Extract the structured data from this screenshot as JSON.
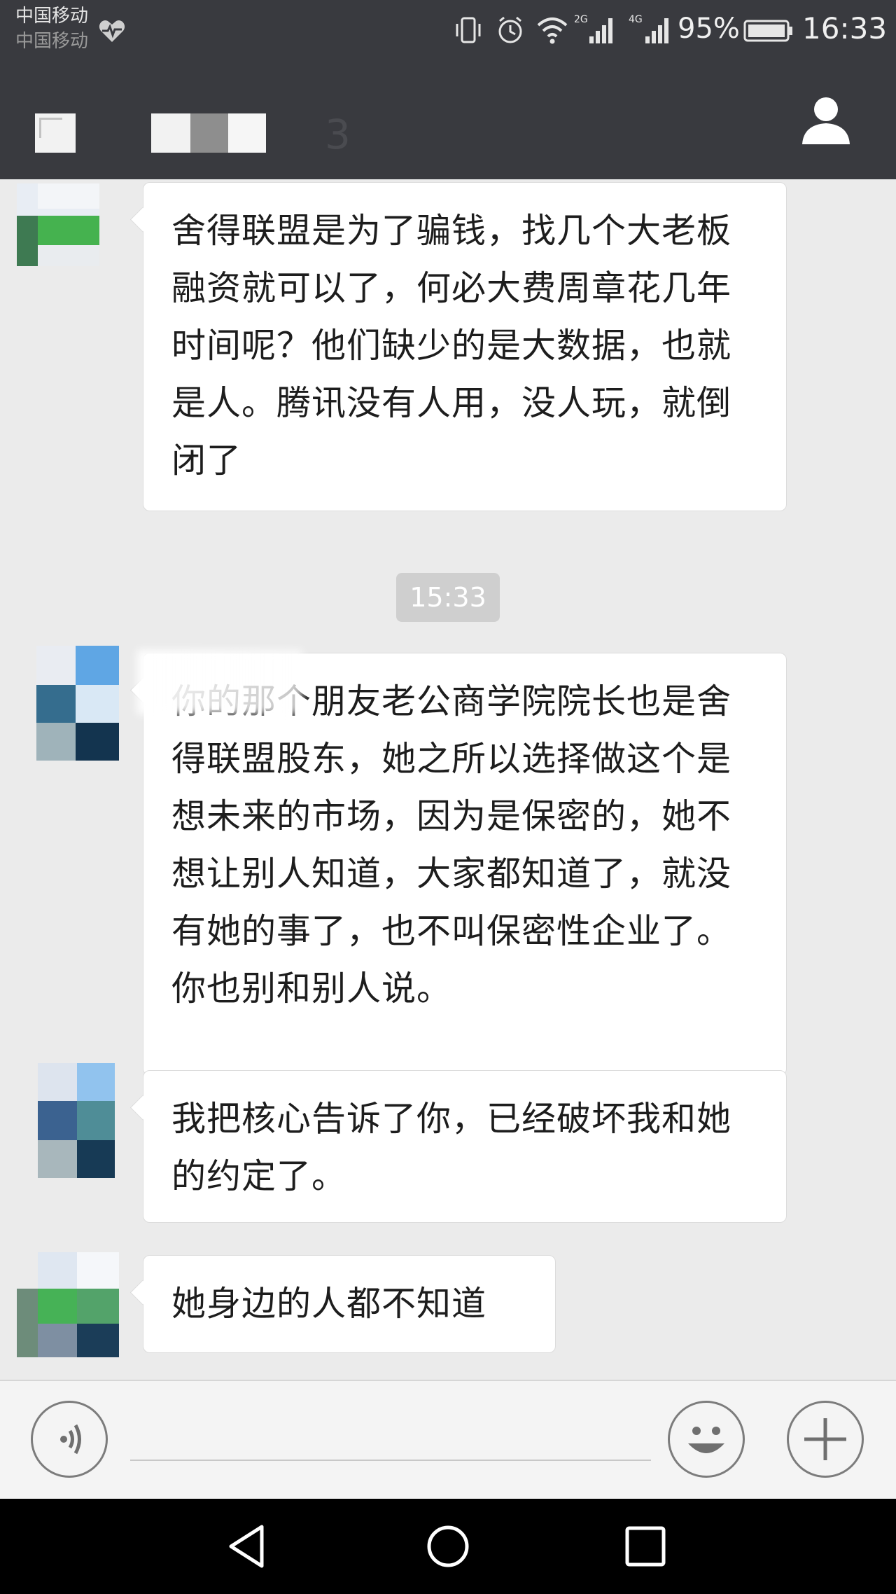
{
  "status_bar": {
    "carrier_1": "中国移动",
    "carrier_2": "中国移动",
    "signal_1_label": "2G",
    "signal_2_label": "4G",
    "battery": "95%",
    "time": "16:33"
  },
  "title_bar": {
    "ghost_text": "3"
  },
  "messages": [
    {
      "text": "舍得联盟是为了骗钱，找几个大老板融资就可以了，何必大费周章花几年时间呢？他们缺少的是大数据，也就是人。腾讯没有人用，没人玩，就倒闭了"
    },
    {
      "text": "你的那个朋友老公商学院院长也是舍得联盟股东，她之所以选择做这个是想未来的市场，因为是保密的，她不想让别人知道，大家都知道了，就没有她的事了，也不叫保密性企业了。你也别和别人说。"
    },
    {
      "text": "我把核心告诉了你，已经破坏我和她的约定了。"
    },
    {
      "text": "她身边的人都不知道"
    }
  ],
  "timestamp": "15:33",
  "input": {
    "placeholder": ""
  },
  "colors": {
    "header_bg": "#393a3f",
    "chat_bg": "#ebebeb",
    "bubble_bg": "#ffffff"
  },
  "icons": {
    "heart": "heart-rate-icon",
    "vibrate": "vibrate-icon",
    "alarm": "alarm-icon",
    "wifi": "wifi-icon",
    "battery": "battery-icon",
    "profile": "person-icon",
    "voice": "voice-icon",
    "emoji": "smiley-icon",
    "plus": "plus-icon",
    "nav_back": "triangle-back-icon",
    "nav_home": "circle-home-icon",
    "nav_recent": "square-recent-icon"
  }
}
